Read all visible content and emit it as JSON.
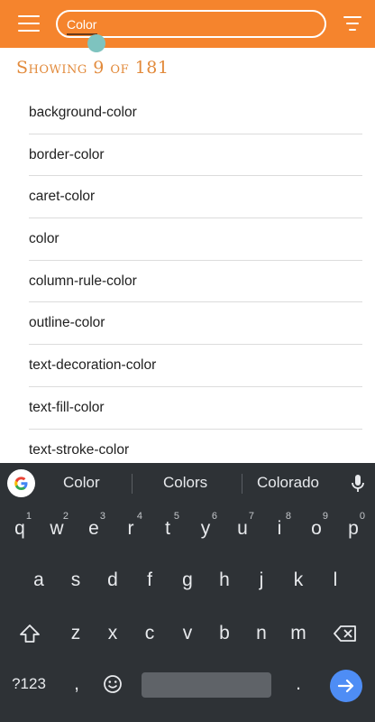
{
  "appbar": {
    "search_value": "Color",
    "accent": "#f5842d",
    "icons": {
      "menu": "hamburger-menu-icon",
      "filter": "filter-icon"
    }
  },
  "heading": "Showing 9 of 181",
  "results": [
    "background-color",
    "border-color",
    "caret-color",
    "color",
    "column-rule-color",
    "outline-color",
    "text-decoration-color",
    "text-fill-color",
    "text-stroke-color"
  ],
  "keyboard": {
    "suggestions": [
      "Color",
      "Colors",
      "Colorado"
    ],
    "row1": [
      {
        "k": "q",
        "h": "1"
      },
      {
        "k": "w",
        "h": "2"
      },
      {
        "k": "e",
        "h": "3"
      },
      {
        "k": "r",
        "h": "4"
      },
      {
        "k": "t",
        "h": "5"
      },
      {
        "k": "y",
        "h": "6"
      },
      {
        "k": "u",
        "h": "7"
      },
      {
        "k": "i",
        "h": "8"
      },
      {
        "k": "o",
        "h": "9"
      },
      {
        "k": "p",
        "h": "0"
      }
    ],
    "row2": [
      "a",
      "s",
      "d",
      "f",
      "g",
      "h",
      "j",
      "k",
      "l"
    ],
    "row3": [
      "z",
      "x",
      "c",
      "v",
      "b",
      "n",
      "m"
    ],
    "symbols_label": "?123",
    "comma": ",",
    "period": ".",
    "colors": {
      "background": "#2e3236",
      "enter": "#4e8df5",
      "spacebar": "#5f6368"
    }
  }
}
